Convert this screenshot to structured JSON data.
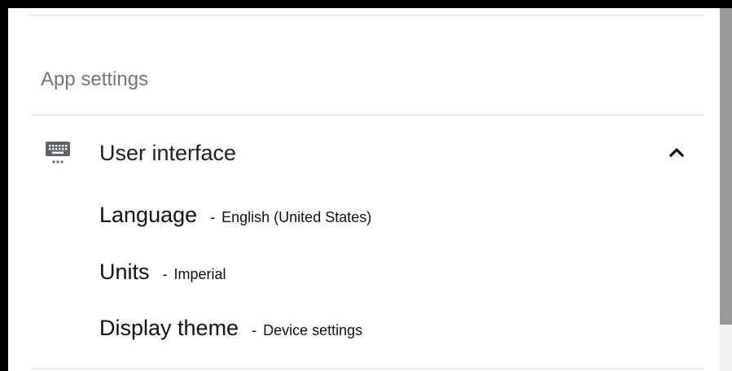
{
  "section": {
    "title": "App settings"
  },
  "group": {
    "label": "User interface",
    "icon": "keyboard-icon",
    "expanded": true,
    "toggle_icon": "chevron-up-icon"
  },
  "settings": [
    {
      "name": "Language",
      "separator": "-",
      "value": "English (United States)"
    },
    {
      "name": "Units",
      "separator": "-",
      "value": "Imperial"
    },
    {
      "name": "Display theme",
      "separator": "-",
      "value": "Device settings"
    }
  ]
}
